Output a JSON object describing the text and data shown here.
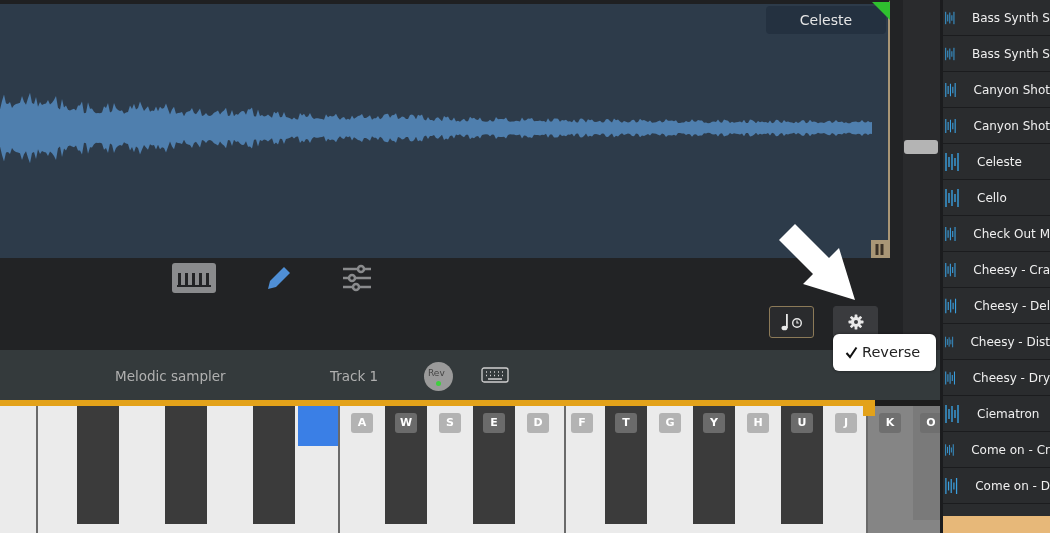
{
  "waveform": {
    "sample_name": "Celeste"
  },
  "tools": [
    {
      "kind": "piano",
      "selected": false
    },
    {
      "kind": "pencil",
      "selected": true
    },
    {
      "kind": "sliders",
      "selected": false
    }
  ],
  "sample_buttons": [
    {
      "kind": "note-timer"
    },
    {
      "kind": "settings"
    }
  ],
  "settings_menu": {
    "items": [
      {
        "label": "Reverse",
        "checked": true
      }
    ]
  },
  "track_bar": {
    "instrument": "Melodic sampler",
    "track": "Track 1",
    "rev_knob": {
      "label": "Rev",
      "on": true
    }
  },
  "keyboard": {
    "keys": [
      {
        "kind": "white",
        "selected": false,
        "disabled": false
      },
      {
        "kind": "white",
        "selected": false,
        "disabled": false
      },
      {
        "kind": "black",
        "selected": false,
        "disabled": false
      },
      {
        "kind": "white",
        "selected": false,
        "disabled": false
      },
      {
        "kind": "black",
        "selected": false,
        "disabled": false
      },
      {
        "kind": "white",
        "selected": false,
        "disabled": false
      },
      {
        "kind": "black",
        "selected": false,
        "disabled": false
      },
      {
        "kind": "white",
        "selected": true,
        "disabled": false
      },
      {
        "kind": "white",
        "label": "A",
        "selected": false,
        "disabled": false
      },
      {
        "kind": "black",
        "label": "W",
        "selected": false,
        "disabled": false
      },
      {
        "kind": "white",
        "label": "S",
        "selected": false,
        "disabled": false
      },
      {
        "kind": "black",
        "label": "E",
        "selected": false,
        "disabled": false
      },
      {
        "kind": "white",
        "label": "D",
        "selected": false,
        "disabled": false
      },
      {
        "kind": "white",
        "label": "F",
        "selected": false,
        "disabled": false
      },
      {
        "kind": "black",
        "label": "T",
        "selected": false,
        "disabled": false
      },
      {
        "kind": "white",
        "label": "G",
        "selected": false,
        "disabled": false
      },
      {
        "kind": "black",
        "label": "Y",
        "selected": false,
        "disabled": false
      },
      {
        "kind": "white",
        "label": "H",
        "selected": false,
        "disabled": false
      },
      {
        "kind": "black",
        "label": "U",
        "selected": false,
        "disabled": false
      },
      {
        "kind": "white",
        "label": "J",
        "selected": false,
        "disabled": false
      },
      {
        "kind": "white",
        "label": "K",
        "selected": false,
        "disabled": true
      },
      {
        "kind": "black",
        "label": "O",
        "selected": false,
        "disabled": true
      }
    ]
  },
  "sample_list": {
    "items": [
      {
        "label": "Bass Synth S"
      },
      {
        "label": "Bass Synth S"
      },
      {
        "label": "Canyon Shot"
      },
      {
        "label": "Canyon Shot"
      },
      {
        "label": "Celeste"
      },
      {
        "label": "Cello"
      },
      {
        "label": "Check Out M"
      },
      {
        "label": "Cheesy - Cra"
      },
      {
        "label": "Cheesy - Del"
      },
      {
        "label": "Cheesy - Dist"
      },
      {
        "label": "Cheesy - Dry"
      },
      {
        "label": "Ciematron"
      },
      {
        "label": "Come on - Cr"
      },
      {
        "label": "Come on - D"
      }
    ]
  }
}
